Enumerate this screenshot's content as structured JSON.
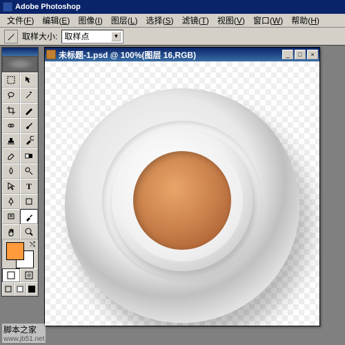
{
  "app": {
    "title": "Adobe Photoshop"
  },
  "menu": {
    "items": [
      {
        "label": "文件",
        "hotkey": "F"
      },
      {
        "label": "编辑",
        "hotkey": "E"
      },
      {
        "label": "图像",
        "hotkey": "I"
      },
      {
        "label": "图层",
        "hotkey": "L"
      },
      {
        "label": "选择",
        "hotkey": "S"
      },
      {
        "label": "滤镜",
        "hotkey": "T"
      },
      {
        "label": "视图",
        "hotkey": "V"
      },
      {
        "label": "窗口",
        "hotkey": "W"
      },
      {
        "label": "帮助",
        "hotkey": "H"
      }
    ]
  },
  "options": {
    "label": "取样大小:",
    "value": "取样点"
  },
  "toolbox": {
    "tools": [
      "marquee",
      "move",
      "lasso",
      "wand",
      "crop",
      "slice",
      "healing",
      "brush",
      "stamp",
      "history",
      "eraser",
      "gradient",
      "blur",
      "dodge",
      "path",
      "type",
      "pen",
      "shape",
      "notes",
      "eyedropper",
      "hand",
      "zoom"
    ],
    "selected": "eyedropper",
    "fg_color": "#ff9a3d",
    "bg_color": "#ffffff"
  },
  "doc": {
    "title": "未标题-1.psd @ 100%(图层 16,RGB)",
    "btns": {
      "min": "_",
      "max": "□",
      "close": "×"
    }
  },
  "watermark": {
    "text": "脚本之家",
    "url": "www.jb51.net"
  }
}
